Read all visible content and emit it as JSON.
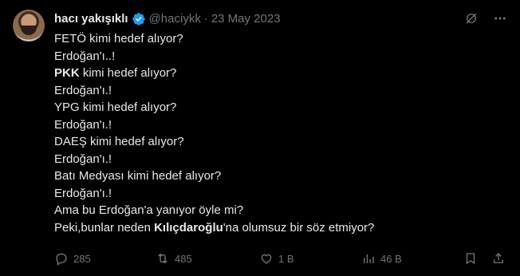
{
  "tweet": {
    "author_name": "hacı yakışıklı",
    "handle": "@haciykk",
    "separator": "·",
    "date": "23 May 2023",
    "lines": [
      {
        "plain": "FETÖ kimi hedef alıyor?"
      },
      {
        "plain": "Erdoğan'ı..!"
      },
      {
        "bold": "PKK",
        "rest": " kimi hedef alıyor?"
      },
      {
        "plain": "Erdoğan'ı.!"
      },
      {
        "plain": "YPG kimi hedef alıyor?"
      },
      {
        "plain": "Erdoğan'ı.!"
      },
      {
        "plain": "DAEŞ kimi hedef alıyor?"
      },
      {
        "plain": "Erdoğan'ı.!"
      },
      {
        "plain": "Batı Medyası kimi hedef alıyor?"
      },
      {
        "plain": "Erdoğan'ı.!"
      },
      {
        "plain": "Ama bu Erdoğan'a yanıyor öyle mi?"
      },
      {
        "pre": "Peki,bunlar neden ",
        "bold": "Kılıçdaroğlu",
        "rest": "'na olumsuz bir söz etmiyor?"
      }
    ]
  },
  "actions": {
    "replies": "285",
    "retweets": "485",
    "likes": "1 B",
    "views": "46 B"
  },
  "colors": {
    "background": "#000000",
    "text": "#e7e9ea",
    "muted": "#71767b",
    "verified": "#1d9bf0"
  }
}
